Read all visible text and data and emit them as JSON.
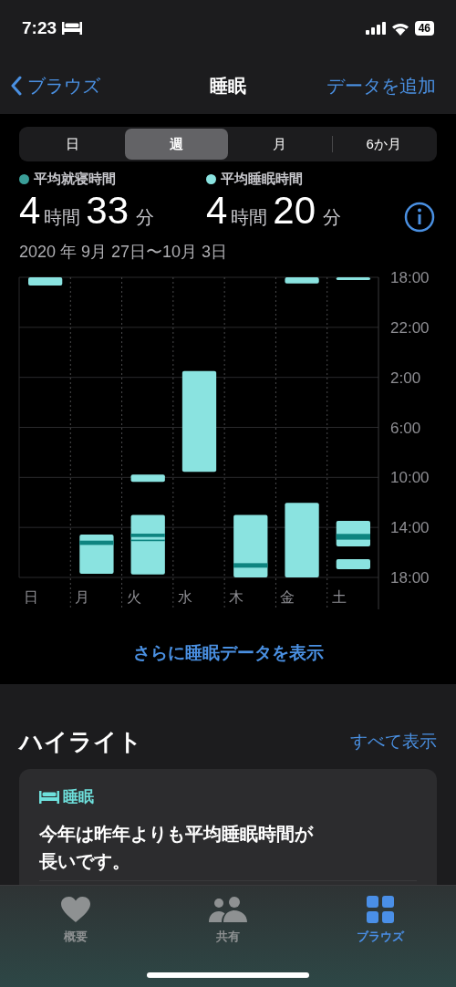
{
  "status_bar": {
    "time": "7:23",
    "battery": "46"
  },
  "nav": {
    "back": "ブラウズ",
    "title": "睡眠",
    "action": "データを追加"
  },
  "segments": [
    {
      "label": "日",
      "selected": false
    },
    {
      "label": "週",
      "selected": true
    },
    {
      "label": "月",
      "selected": false
    },
    {
      "label": "6か月",
      "selected": false
    }
  ],
  "stats": [
    {
      "label": "平均就寝時間",
      "color": "#3a9e98",
      "hours": "4",
      "hours_unit": "時間",
      "minutes": "33",
      "minutes_unit": "分"
    },
    {
      "label": "平均睡眠時間",
      "color": "#8ae3e0",
      "hours": "4",
      "hours_unit": "時間",
      "minutes": "20",
      "minutes_unit": "分"
    }
  ],
  "date_range": "2020 年 9月 27日〜10月 3日",
  "chart": {
    "time_labels": [
      "18:00",
      "22:00",
      "2:00",
      "6:00",
      "10:00",
      "14:00",
      "18:00"
    ],
    "day_labels": [
      "日",
      "月",
      "火",
      "水",
      "木",
      "金",
      "土"
    ]
  },
  "more_link": "さらに睡眠データを表示",
  "highlights": {
    "title": "ハイライト",
    "show_all": "すべて表示",
    "cards": [
      {
        "category": "睡眠",
        "text": "今年は昨年よりも平均睡眠時間が長いです。"
      }
    ]
  },
  "tab_bar": [
    {
      "label": "概要",
      "selected": false,
      "kind": "heart"
    },
    {
      "label": "共有",
      "selected": false,
      "kind": "people"
    },
    {
      "label": "ブラウズ",
      "selected": true,
      "kind": "grid"
    }
  ]
}
